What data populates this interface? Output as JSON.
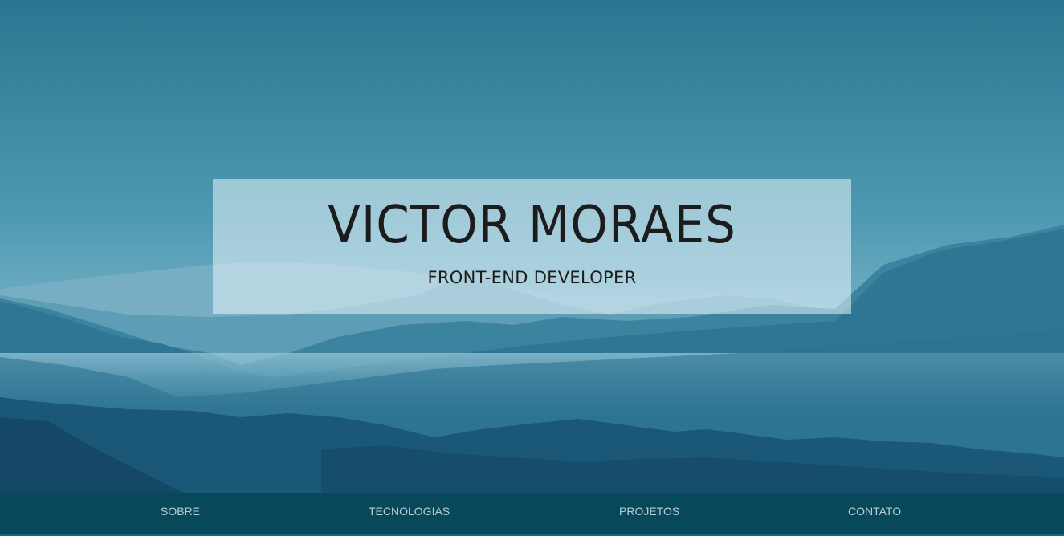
{
  "hero": {
    "name": "VICTOR MORAES",
    "role": "FRONT-END DEVELOPER"
  },
  "nav": {
    "items": [
      {
        "label": "SOBRE"
      },
      {
        "label": "TECNOLOGIAS"
      },
      {
        "label": "PROJETOS"
      },
      {
        "label": "CONTATO"
      }
    ]
  },
  "colors": {
    "sky": "#3d8ba6",
    "navbar": "#07485a",
    "nav_text": "#b9cdd3",
    "title_text": "#1c1c1c"
  }
}
